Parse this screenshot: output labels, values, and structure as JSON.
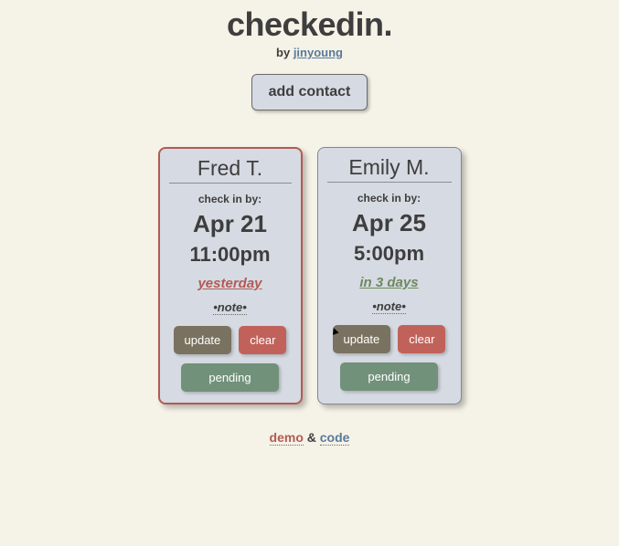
{
  "header": {
    "title": "checkedin.",
    "by_prefix": "by ",
    "by_author": "jinyoung"
  },
  "actions": {
    "add_contact": "add contact"
  },
  "contacts": [
    {
      "name": "Fred T.",
      "checkin_label": "check in by:",
      "date": "Apr 21",
      "time": "11:00pm",
      "relative": "yesterday",
      "relative_class": "overdue-text",
      "card_class": "overdue",
      "note": "•note•",
      "update": "update",
      "clear": "clear",
      "pending": "pending"
    },
    {
      "name": "Emily M.",
      "checkin_label": "check in by:",
      "date": "Apr 25",
      "time": "5:00pm",
      "relative": "in 3 days",
      "relative_class": "upcoming-text",
      "card_class": "normal",
      "note": "•note•",
      "update": "update",
      "clear": "clear",
      "pending": "pending"
    }
  ],
  "footer": {
    "demo": "demo",
    "amp": " & ",
    "code": "code"
  }
}
